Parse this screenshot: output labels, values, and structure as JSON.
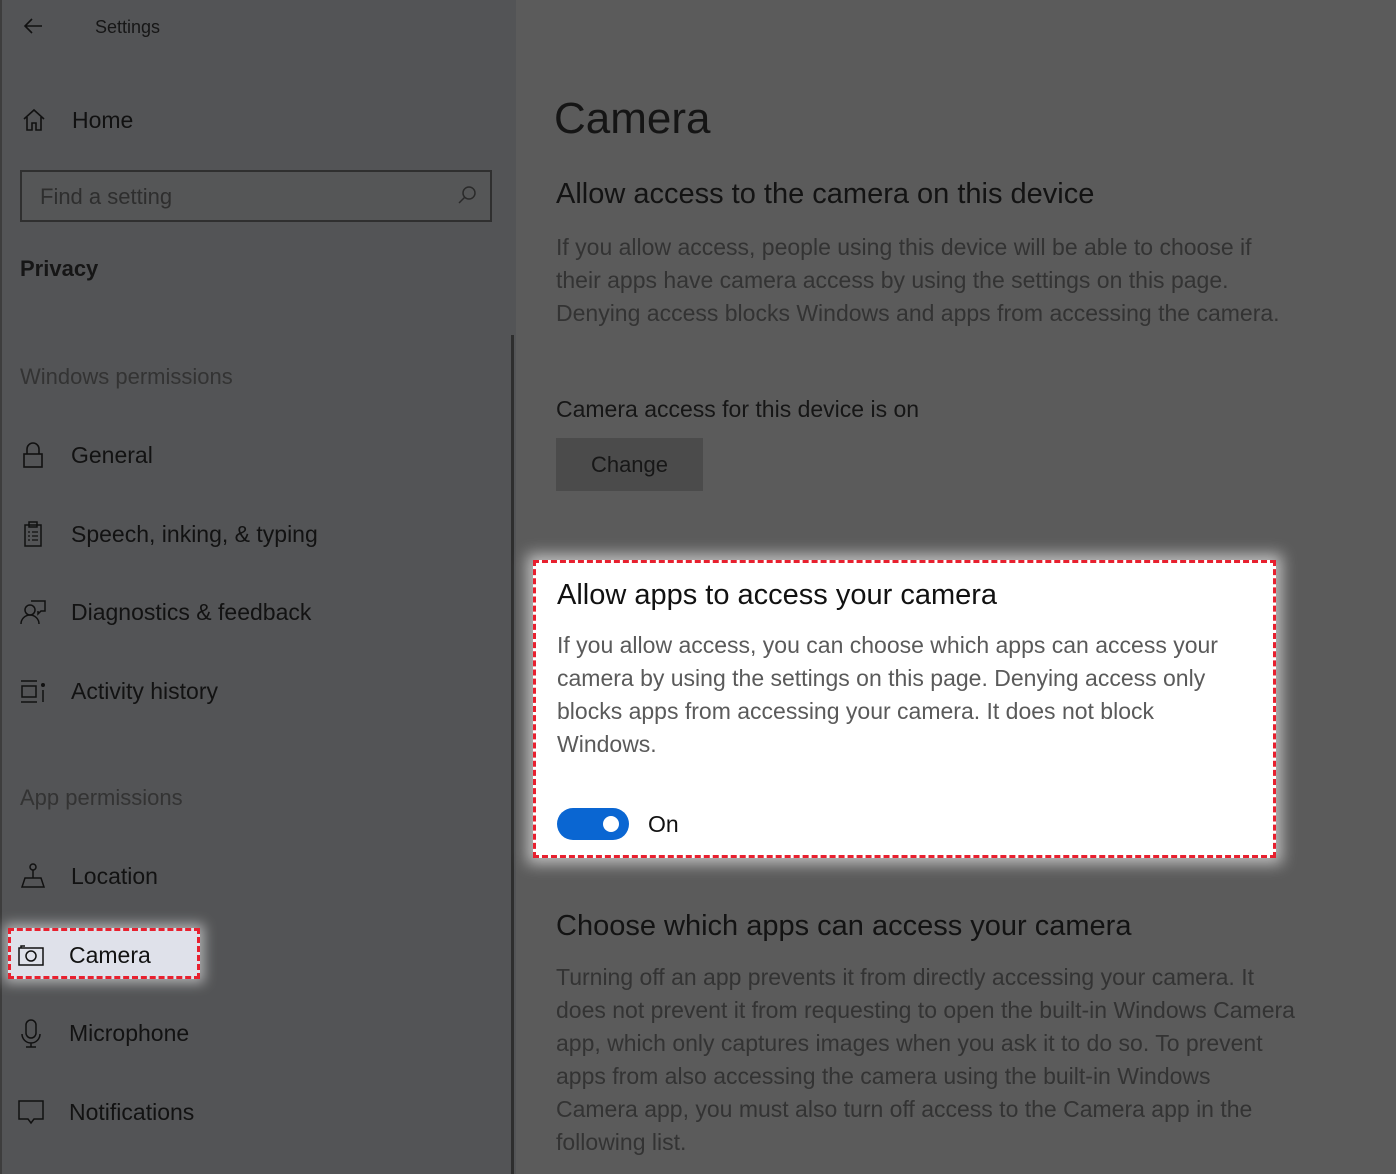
{
  "window": {
    "title": "Settings",
    "back_icon": "arrow-left-icon"
  },
  "sidebar": {
    "home": {
      "label": "Home",
      "icon": "home-icon"
    },
    "search": {
      "placeholder": "Find a setting",
      "value": "",
      "icon": "search-icon"
    },
    "section_title": "Privacy",
    "groups": [
      {
        "label": "Windows permissions",
        "items": [
          {
            "label": "General",
            "icon": "lock-icon"
          },
          {
            "label": "Speech, inking, & typing",
            "icon": "clipboard-icon"
          },
          {
            "label": "Diagnostics & feedback",
            "icon": "person-feedback-icon"
          },
          {
            "label": "Activity history",
            "icon": "timeline-icon"
          }
        ]
      },
      {
        "label": "App permissions",
        "items": [
          {
            "label": "Location",
            "icon": "location-icon"
          },
          {
            "label": "Camera",
            "icon": "camera-icon",
            "selected": true,
            "highlighted": true
          },
          {
            "label": "Microphone",
            "icon": "microphone-icon"
          },
          {
            "label": "Notifications",
            "icon": "notification-icon"
          }
        ]
      }
    ]
  },
  "main": {
    "title": "Camera",
    "device_access": {
      "heading": "Allow access to the camera on this device",
      "description": "If you allow access, people using this device will be able to choose if their apps have camera access by using the settings on this page. Denying access blocks Windows and apps from accessing the camera.",
      "status": "Camera access for this device is on",
      "button_label": "Change"
    },
    "app_access": {
      "heading": "Allow apps to access your camera",
      "description": "If you allow access, you can choose which apps can access your camera by using the settings on this page. Denying access only blocks apps from accessing your camera. It does not block Windows.",
      "toggle_on": true,
      "toggle_label": "On",
      "highlighted": true
    },
    "choose_apps": {
      "heading": "Choose which apps can access your camera",
      "description": "Turning off an app prevents it from directly accessing your camera. It does not prevent it from requesting to open the built-in Windows Camera app, which only captures images when you ask it to do so. To prevent apps from also accessing the camera using the built-in Windows Camera app, you must also turn off access to the Camera app in the following list."
    }
  },
  "colors": {
    "highlight_border": "#e8202f",
    "toggle_on": "#0a66d2",
    "dim_overlay": "#5b5b5b"
  }
}
